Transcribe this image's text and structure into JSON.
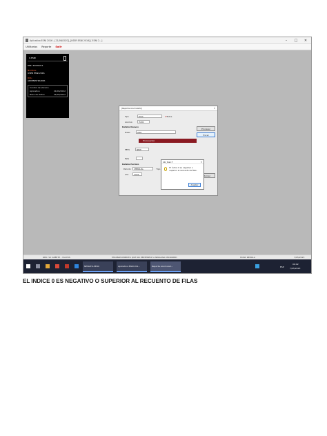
{
  "window": {
    "title": "Aplicativo ESNI 2016 - [21/06/2022]_[USER ESNI 2016] [ ESNI 2...]",
    "min": "–",
    "max": "□",
    "close": "✕"
  },
  "menu": {
    "utilitarios": "Utilitarios",
    "reporte": "Reporte",
    "salir": "Salir"
  },
  "user_panel": {
    "username": "U.ESNI",
    "dni_label": "DNI:",
    "dni_value": "44020211",
    "nombre_label": "Nombre:",
    "nombre_value": "USER ESNI 2016",
    "rol_label": "ROL:",
    "rol_value": "ADMINISTRADOR",
    "control_title": "Control de Version",
    "aplicativo_label": "Aplicativo",
    "aplicativo_value": "21/06/2022",
    "base_label": "Base de Datos",
    "base_value": "21/06/2022"
  },
  "report_dialog": {
    "title": "[Reporte Acumulado]",
    "tipo_label": "Tipo",
    "tipo_value": "DISA",
    "todos_label": "Todos",
    "nuevo_label": "Acumul.",
    "nuevo_value": "E200",
    "detalle_label": "Detalle Nuevos",
    "disa_label": "Disas",
    "disa_value": "LIMA",
    "procesando": "Procesando",
    "eess_label": "EESS",
    "eess_value": "NEW",
    "esta_label": "Esta",
    "periodo_title": "Detalle Periodo",
    "periodo_label": "Periodo",
    "periodo_value": "MENSUAL",
    "tipo2_label": "Tipo",
    "tipo2_value": "Meses",
    "anio_label": "Año",
    "anio_value": "2022",
    "procesar": "Procesar",
    "excel": "Excel",
    "retornar": "Retornar"
  },
  "message_box": {
    "title": "bbl_tbarr.7",
    "text": "El índice 0 es negativo o superior al recuento de filas.",
    "ok": "Aceptar"
  },
  "status_bar": {
    "red": "RED: VII CAÑETE - YAUYOS",
    "establecimiento": "ESTABLECIMIENTO QUE NO PERTENECE A NINGUNA MICRORED",
    "hosp": "HOSP. REZOLA",
    "fecha": "7/05/2023"
  },
  "taskbar": {
    "item1": "NEWATO-PERU",
    "item2": "Aplicativo ESNI 201...",
    "item3": "Reporte Acumulad...",
    "lang": "ESP",
    "time": "09:02",
    "date": "7/05/2023"
  },
  "caption": "EL INDICE 0 ES NEGATIVO O SUPERIOR AL RECUENTO DE FILAS"
}
